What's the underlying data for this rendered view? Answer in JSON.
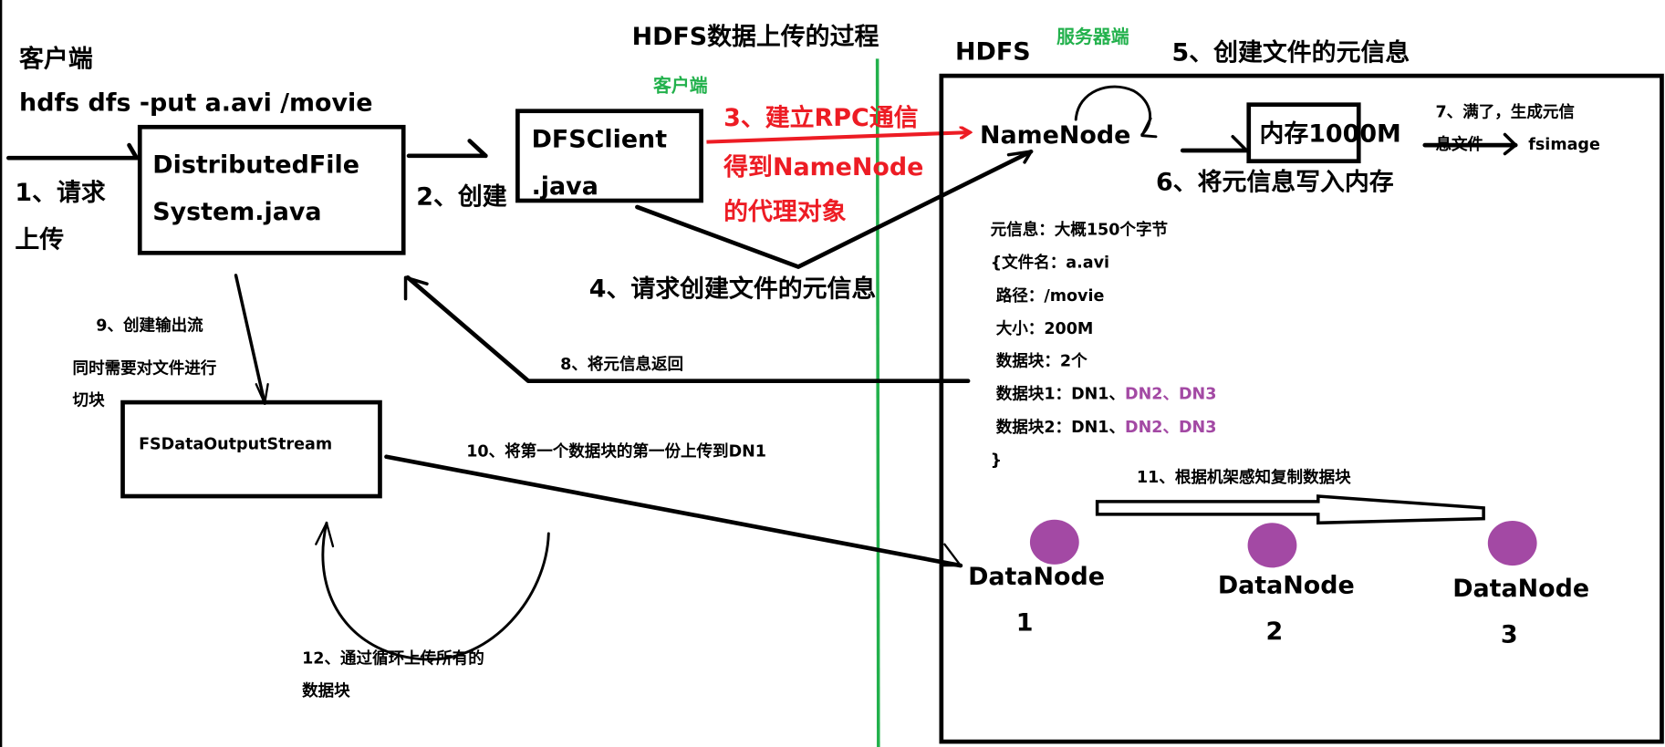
{
  "title": "HDFS数据上传的过程",
  "colors": {
    "green": "#22b14c",
    "red": "#ed1c24",
    "purple": "#a349a4",
    "black": "#000000"
  },
  "client": {
    "heading": "客户端",
    "command": "hdfs dfs  -put a.avi /movie",
    "side_label": "客户端",
    "step1": [
      "1、请求",
      "上传"
    ],
    "dfs_box": [
      "DistributedFile",
      "System.java"
    ],
    "step2": "2、创建",
    "client_box": [
      "DFSClient",
      ".java"
    ],
    "step3": [
      "3、建立RPC通信",
      "得到NameNode",
      "的代理对象"
    ],
    "step4": "4、请求创建文件的元信息",
    "step8": "8、将元信息返回",
    "step9": [
      "9、创建输出流",
      "同时需要对文件进行",
      "切块"
    ],
    "stream_box": "FSDataOutputStream",
    "step10": "10、将第一个数据块的第一份上传到DN1",
    "step12": [
      "12、通过循环上传所有的",
      "数据块"
    ]
  },
  "server": {
    "hdfs_label": "HDFS",
    "side_label": "服务器端",
    "step5": "5、创建文件的元信息",
    "namenode": "NameNode",
    "memory_box": "内存1000M",
    "step6": "6、将元信息写入内存",
    "step7": [
      "7、满了，生成元信",
      "息文件",
      "fsimage"
    ],
    "metadata": {
      "header": "元信息：大概150个字节",
      "name": "{文件名：a.avi",
      "path": " 路径：/movie",
      "size": " 大小：200M",
      "blocks": " 数据块：2个",
      "block1": {
        "prefix": " 数据块1：DN1、",
        "replicas": "DN2、DN3"
      },
      "block2": {
        "prefix": " 数据块2：DN1、",
        "replicas": "DN2、DN3"
      },
      "close": "}"
    },
    "step11": "11、根据机架感知复制数据块",
    "datanodes": [
      {
        "label": "DataNode",
        "number": "1"
      },
      {
        "label": "DataNode",
        "number": "2"
      },
      {
        "label": "DataNode",
        "number": "3"
      }
    ]
  }
}
